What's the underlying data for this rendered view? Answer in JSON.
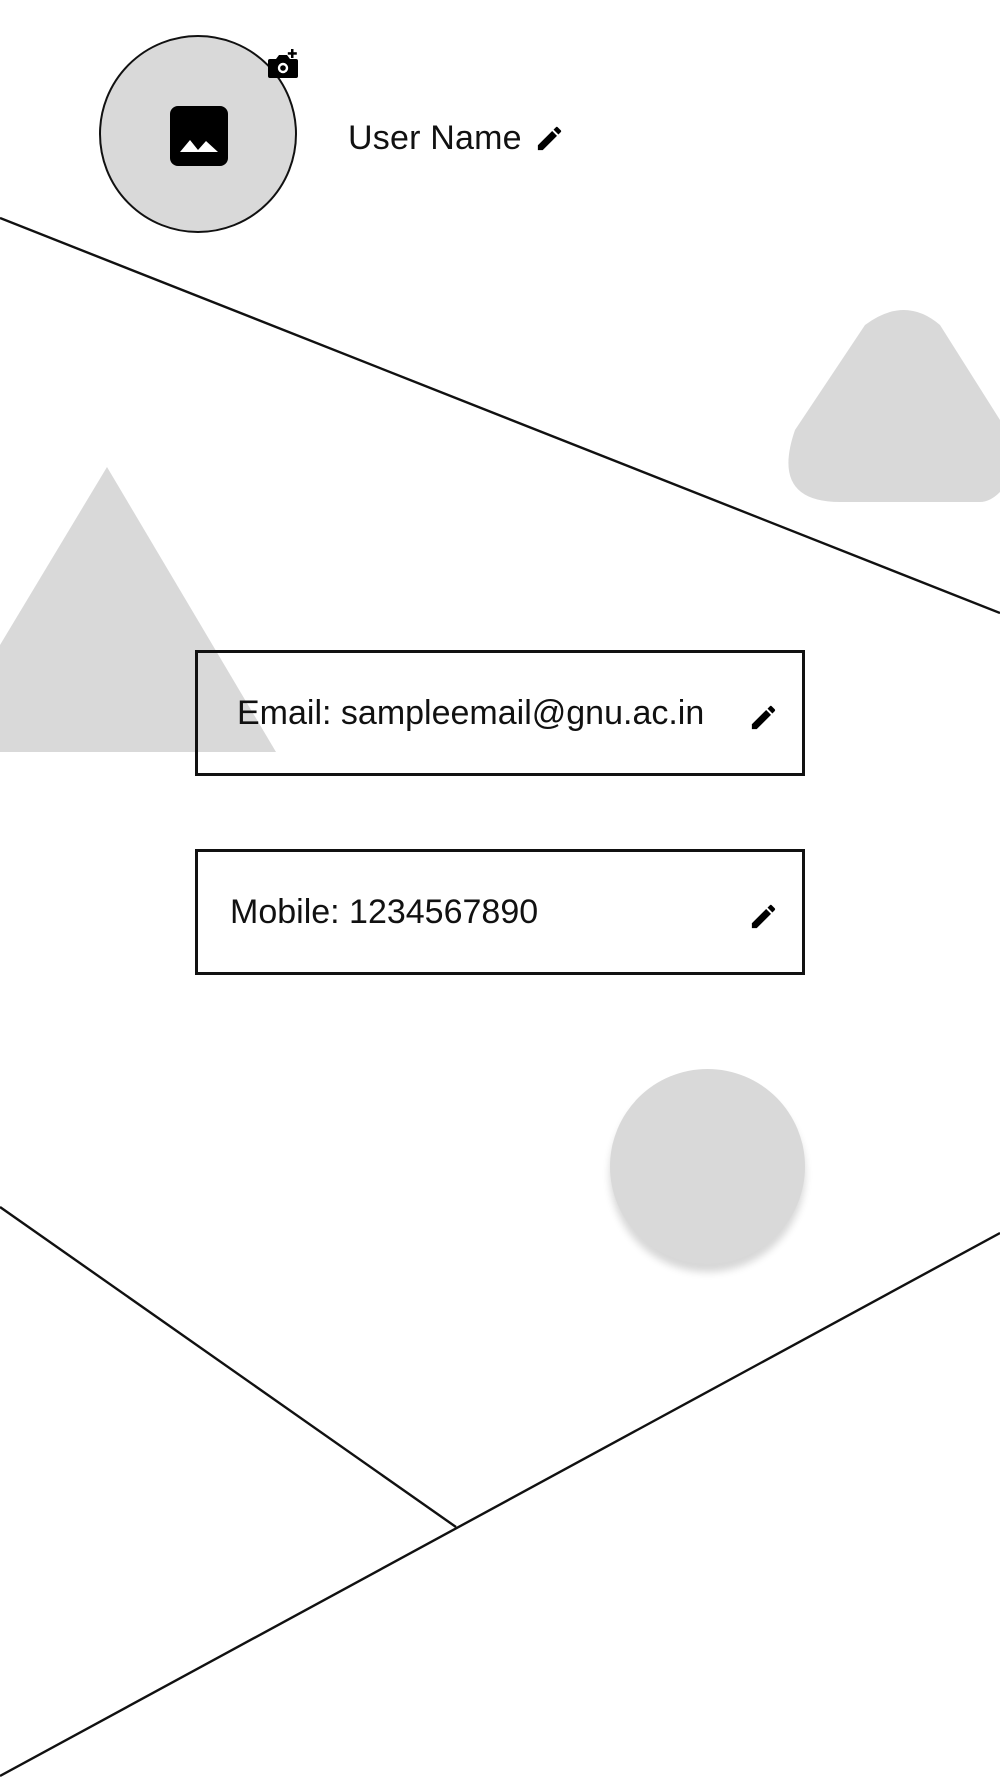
{
  "profile": {
    "avatar_icon": "image-icon",
    "camera_icon": "camera-plus-icon",
    "user_name": "User Name",
    "edit_icon": "pencil-icon"
  },
  "fields": {
    "email": {
      "label": "Email: sampleemail@gnu.ac.in",
      "edit_icon": "pencil-icon"
    },
    "mobile": {
      "label": "Mobile: 1234567890",
      "edit_icon": "pencil-icon"
    }
  },
  "colors": {
    "background": "#ffffff",
    "line": "#111111",
    "placeholder_gray": "#d9d9d9",
    "icon": "#000000"
  }
}
